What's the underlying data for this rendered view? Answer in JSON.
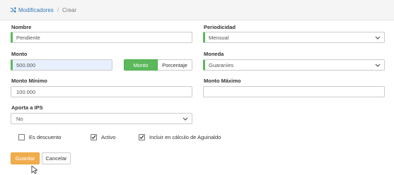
{
  "breadcrumb": {
    "section": "Modificadores",
    "current": "Crear"
  },
  "form": {
    "nombre": {
      "label": "Nombre",
      "value": "Pendiente"
    },
    "periodicidad": {
      "label": "Periodicidad",
      "value": "Mensual"
    },
    "monto": {
      "label": "Monto",
      "value": "500.000"
    },
    "tipo_monto": {
      "options": [
        "Monto",
        "Porcentaje"
      ],
      "selected": "Monto"
    },
    "moneda": {
      "label": "Moneda",
      "value": "Guaraníes"
    },
    "monto_minimo": {
      "label": "Monto Mínimo",
      "value": "100.000"
    },
    "monto_maximo": {
      "label": "Monto Máximo",
      "value": ""
    },
    "aporta_ips": {
      "label": "Aporta a IPS",
      "value": "No"
    },
    "checkboxes": [
      {
        "label": "Es descuento",
        "checked": false
      },
      {
        "label": "Activo",
        "checked": true
      },
      {
        "label": "Incluir en cálculo de Aguinaldo",
        "checked": true
      }
    ]
  },
  "buttons": {
    "save": "Guardar",
    "cancel": "Cancelar"
  },
  "colors": {
    "required_bar": "#5cb85c",
    "primary": "#f0ad4e",
    "link": "#337ab7",
    "active_toggle": "#5cb85c"
  }
}
